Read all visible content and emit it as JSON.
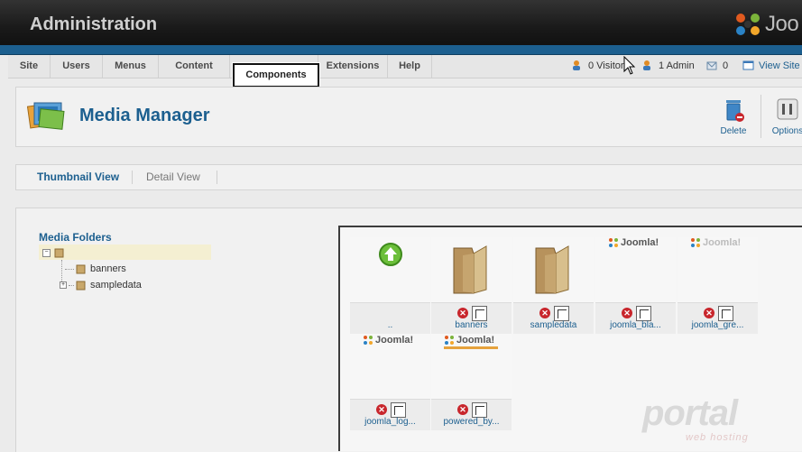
{
  "header": {
    "title": "Administration",
    "logo_text": "Joo"
  },
  "menu": {
    "items": [
      "Site",
      "Users",
      "Menus",
      "Content",
      "Components",
      "Extensions",
      "Help"
    ],
    "highlighted": "Components"
  },
  "status": {
    "visitors": "0 Visitor",
    "admins": "1 Admin",
    "messages": "0",
    "view_site": "View Site"
  },
  "toolbar": {
    "title": "Media Manager",
    "delete_label": "Delete",
    "options_label": "Options"
  },
  "views": {
    "thumbnail": "Thumbnail View",
    "detail": "Detail View"
  },
  "media_folders": {
    "title": "Media Folders",
    "folders": [
      "banners",
      "sampledata"
    ]
  },
  "thumbnails": [
    {
      "name": "..",
      "kind": "up"
    },
    {
      "name": "banners",
      "kind": "folder"
    },
    {
      "name": "sampledata",
      "kind": "folder"
    },
    {
      "name": "joomla_bla...",
      "kind": "image",
      "logo": "Joomla!"
    },
    {
      "name": "joomla_gre...",
      "kind": "image",
      "logo": "Joomla!"
    },
    {
      "name": "joomla_log...",
      "kind": "image",
      "logo": "Joomla!"
    },
    {
      "name": "powered_by...",
      "kind": "image",
      "logo": "Joomla!"
    }
  ],
  "watermark": {
    "brand": "portal",
    "sub": "web hosting"
  },
  "colors": {
    "accent": "#1c5f8f",
    "header_bg": "#1a1a1a",
    "delete_red": "#c8262c"
  }
}
